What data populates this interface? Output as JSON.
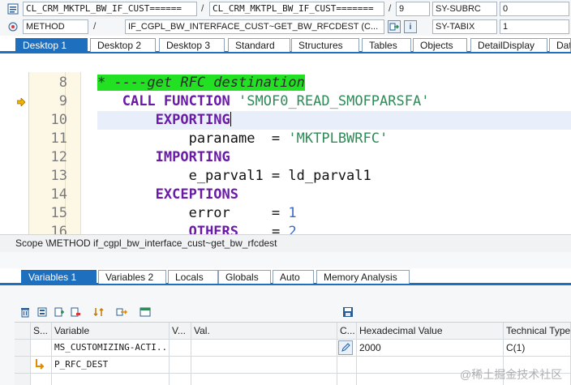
{
  "header": {
    "row1": {
      "program": "CL_CRM_MKTPL_BW_IF_CUST======",
      "include": "CL_CRM_MKTPL_BW_IF_CUST=======",
      "line": "9",
      "sysvar1_name": "SY-SUBRC",
      "sysvar1_value": "0"
    },
    "row2": {
      "event_type": "METHOD",
      "event_name": "IF_CGPL_BW_INTERFACE_CUST~GET_BW_RFCDEST (C...",
      "sysvar2_name": "SY-TABIX",
      "sysvar2_value": "1"
    },
    "separator": "/"
  },
  "desktop_tabs": [
    "Desktop 1",
    "Desktop 2",
    "Desktop 3",
    "Standard",
    "Structures",
    "Tables",
    "Objects",
    "DetailDisplay",
    "Dat"
  ],
  "code": {
    "lines": [
      {
        "num": "8",
        "parts": [
          {
            "t": "* ----get RFC destination",
            "c": "cmt"
          }
        ]
      },
      {
        "num": "9",
        "parts": [
          {
            "t": "   ",
            "c": "var"
          },
          {
            "t": "CALL FUNCTION",
            "c": "kw"
          },
          {
            "t": " ",
            "c": "var"
          },
          {
            "t": "'SMOF0_READ_SMOFPARSFA'",
            "c": "str"
          }
        ]
      },
      {
        "num": "10",
        "parts": [
          {
            "t": "       ",
            "c": "var"
          },
          {
            "t": "EXPORTING",
            "c": "kw"
          }
        ]
      },
      {
        "num": "11",
        "parts": [
          {
            "t": "           paraname  = ",
            "c": "var"
          },
          {
            "t": "'MKTPLBWRFC'",
            "c": "str"
          }
        ]
      },
      {
        "num": "12",
        "parts": [
          {
            "t": "       ",
            "c": "var"
          },
          {
            "t": "IMPORTING",
            "c": "kw"
          }
        ]
      },
      {
        "num": "13",
        "parts": [
          {
            "t": "           e_parval1 = ld_parval1",
            "c": "var"
          }
        ]
      },
      {
        "num": "14",
        "parts": [
          {
            "t": "       ",
            "c": "var"
          },
          {
            "t": "EXCEPTIONS",
            "c": "kw"
          }
        ]
      },
      {
        "num": "15",
        "parts": [
          {
            "t": "           error     = ",
            "c": "var"
          },
          {
            "t": "1",
            "c": "num"
          }
        ]
      },
      {
        "num": "16",
        "parts": [
          {
            "t": "           ",
            "c": "var"
          },
          {
            "t": "OTHERS",
            "c": "kw"
          },
          {
            "t": "    = ",
            "c": "var"
          },
          {
            "t": "2",
            "c": "num"
          }
        ]
      }
    ]
  },
  "scope": "Scope \\METHOD if_cgpl_bw_interface_cust~get_bw_rfcdest",
  "variable_tabs": [
    "Variables 1",
    "Variables 2",
    "Locals",
    "Globals",
    "Auto",
    "Memory Analysis"
  ],
  "grid": {
    "headers": [
      "S...",
      "Variable",
      "V...",
      "Val.",
      "C...",
      "Hexadecimal Value",
      "Technical Type"
    ],
    "rows": [
      {
        "variable": "MS_CUSTOMIZING-ACTI...",
        "hex": "2000",
        "type": "C(1)"
      },
      {
        "variable": "P_RFC_DEST",
        "hex": "",
        "type": ""
      }
    ]
  },
  "watermark": "@稀土掘金技术社区",
  "icons": {
    "program": "program-icon",
    "method": "method-icon",
    "navigate": "navigate-icon",
    "info": "info-icon",
    "breakpoint_arrow": "current-line-arrow-icon"
  },
  "colors": {
    "accent": "#1f6fbf",
    "keyword": "#6a1aa6",
    "string": "#2e8b57",
    "comment_bg": "#22e022"
  }
}
